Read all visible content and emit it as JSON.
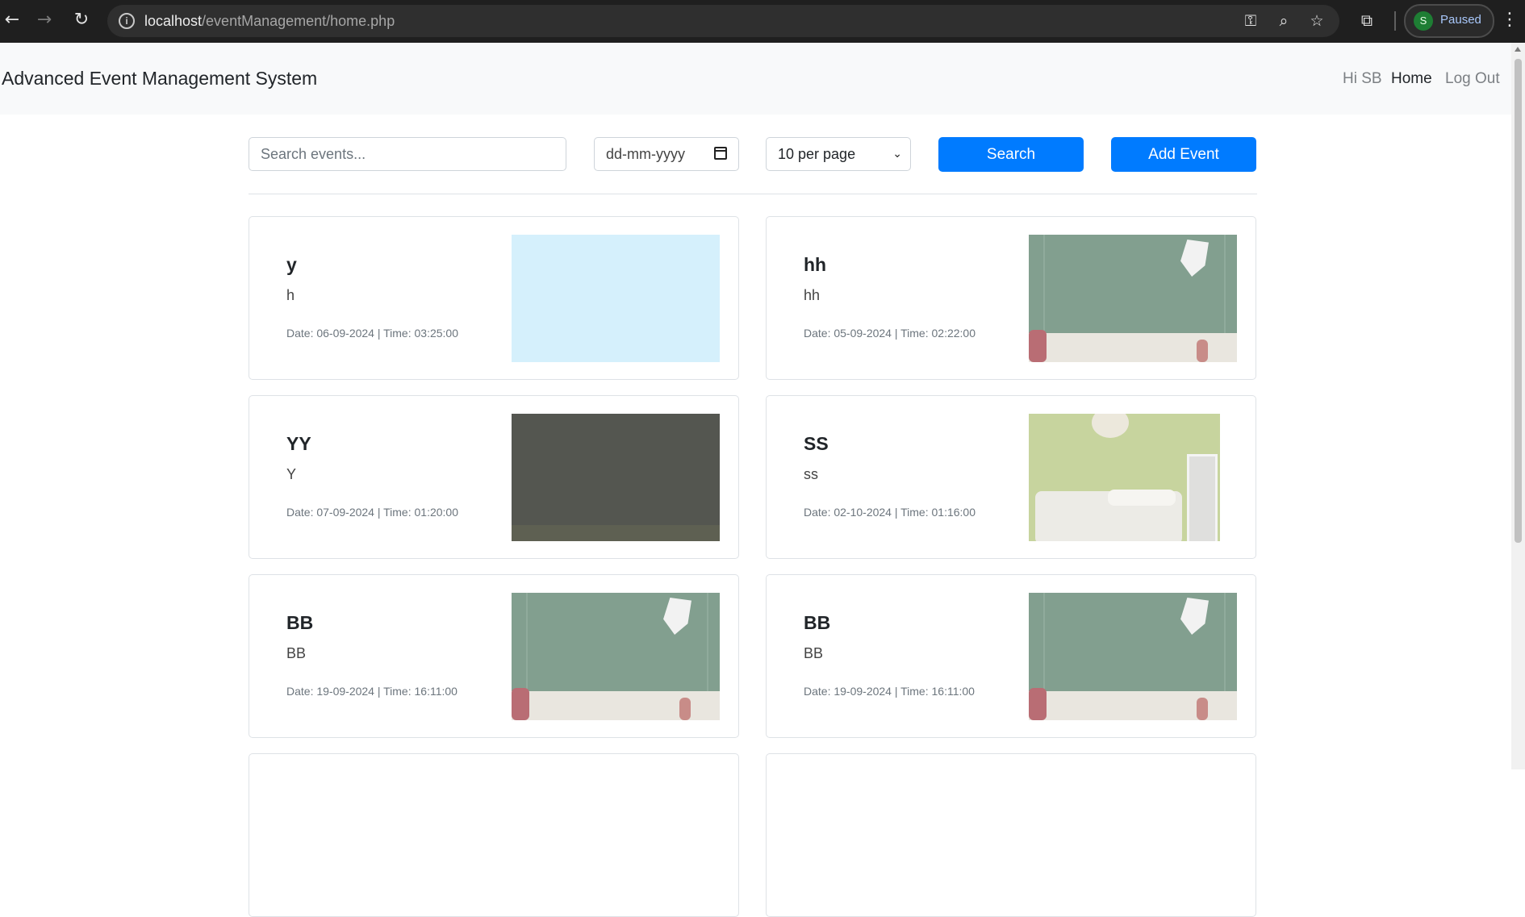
{
  "browser": {
    "url_host": "localhost",
    "url_path": "/eventManagement/home.php",
    "profile_initial": "S",
    "profile_status": "Paused"
  },
  "navbar": {
    "brand": "Advanced Event Management System",
    "greeting": "Hi SB",
    "home": "Home",
    "logout": "Log Out"
  },
  "filters": {
    "search_placeholder": "Search events...",
    "date_placeholder": "dd-mm-yyyy",
    "per_page": "10 per page",
    "search_button": "Search",
    "add_button": "Add Event"
  },
  "events": [
    {
      "title": "y",
      "description": "h",
      "meta": "Date: 06-09-2024 | Time: 03:25:00"
    },
    {
      "title": "hh",
      "description": "hh",
      "meta": "Date: 05-09-2024 | Time: 02:22:00"
    },
    {
      "title": "YY",
      "description": "Y",
      "meta": "Date: 07-09-2024 | Time: 01:20:00"
    },
    {
      "title": "SS",
      "description": "ss",
      "meta": "Date: 02-10-2024 | Time: 01:16:00"
    },
    {
      "title": "BB",
      "description": "BB",
      "meta": "Date: 19-09-2024 | Time: 16:11:00"
    },
    {
      "title": "BB",
      "description": "BB",
      "meta": "Date: 19-09-2024 | Time: 16:11:00"
    }
  ],
  "colors": {
    "primary": "#007bff",
    "navbar_bg": "#f8f9fa",
    "browser_bg": "#1f1f1f"
  }
}
